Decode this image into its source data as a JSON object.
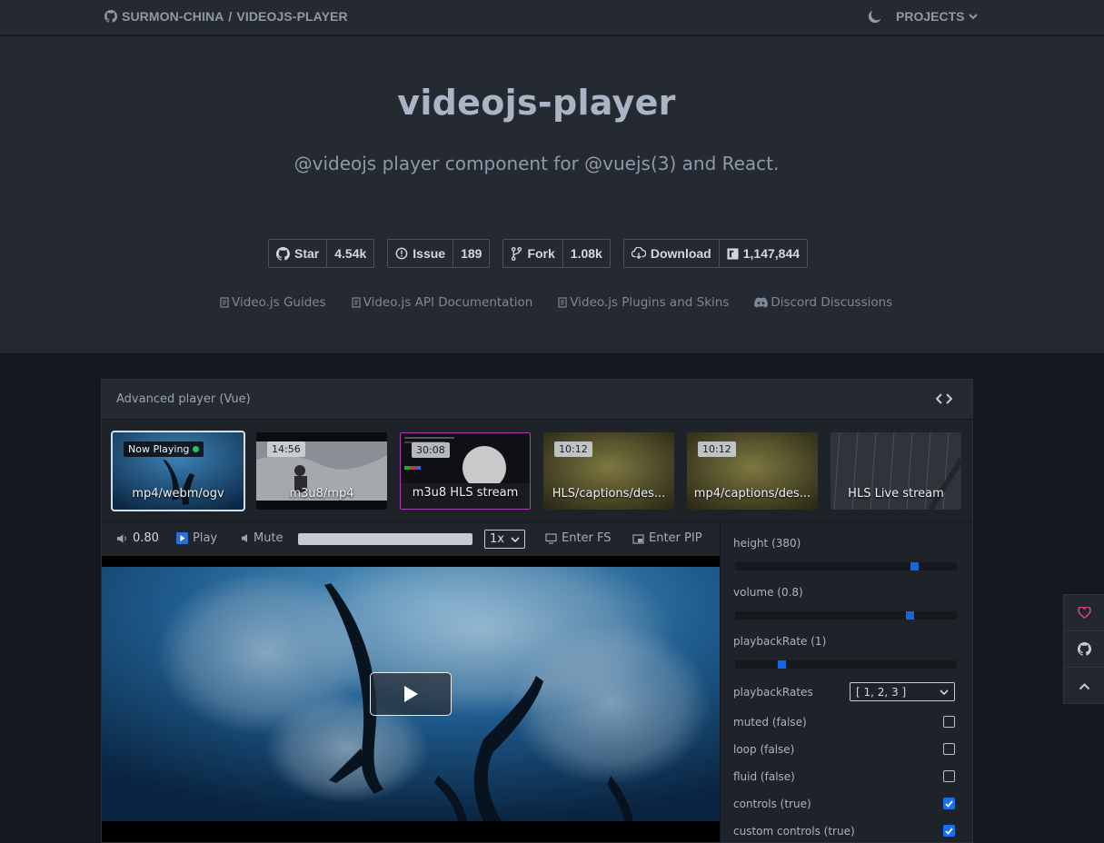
{
  "nav": {
    "owner": "SURMON-CHINA",
    "separator": "/",
    "repo": "VIDEOJS-PLAYER",
    "projects_label": "PROJECTS"
  },
  "hero": {
    "title": "videojs-player",
    "subtitle": "@videojs player component for @vuejs(3) and React.",
    "badges": [
      {
        "label": "Star",
        "count": "4.54k",
        "icon": "github-icon"
      },
      {
        "label": "Issue",
        "count": "189",
        "icon": "issue-icon"
      },
      {
        "label": "Fork",
        "count": "1.08k",
        "icon": "fork-icon"
      },
      {
        "label": "Download",
        "count": "1,147,844",
        "icon": "download-icon"
      }
    ],
    "links": [
      {
        "label": "Video.js Guides",
        "icon": "document-icon"
      },
      {
        "label": "Video.js API Documentation",
        "icon": "document-icon"
      },
      {
        "label": "Video.js Plugins and Skins",
        "icon": "document-icon"
      },
      {
        "label": "Discord Discussions",
        "icon": "discord-icon"
      }
    ]
  },
  "demo": {
    "title": "Advanced player (Vue)",
    "playlist": [
      {
        "name": "mp4/webm/ogv",
        "badge": "Now Playing",
        "active": true
      },
      {
        "name": "m3u8/mp4",
        "badge": "14:56"
      },
      {
        "name": "m3u8 HLS stream",
        "badge": "30:08"
      },
      {
        "name": "HLS/captions/des...",
        "badge": "10:12"
      },
      {
        "name": "mp4/captions/des...",
        "badge": "10:12"
      },
      {
        "name": "HLS Live stream",
        "badge": ""
      }
    ],
    "controls": {
      "volume": "0.80",
      "play": "Play",
      "mute": "Mute",
      "rate": "1x",
      "fullscreen": "Enter FS",
      "pip": "Enter PIP"
    },
    "options": {
      "height_label": "height (380)",
      "height_value": 0.82,
      "volume_label": "volume (0.8)",
      "volume_value": 0.8,
      "rate_label": "playbackRate (1)",
      "rate_value": 0.2,
      "rates_label": "playbackRates",
      "rates_value": "[ 1, 2, 3 ]",
      "checks": [
        {
          "label": "muted (false)",
          "checked": false
        },
        {
          "label": "loop (false)",
          "checked": false
        },
        {
          "label": "fluid (false)",
          "checked": false
        },
        {
          "label": "controls (true)",
          "checked": true
        },
        {
          "label": "custom controls (true)",
          "checked": true
        }
      ]
    }
  },
  "colors": {
    "accent": "#1565e6",
    "heart": "#e83e8c",
    "now_playing_dot": "#22c55e"
  }
}
